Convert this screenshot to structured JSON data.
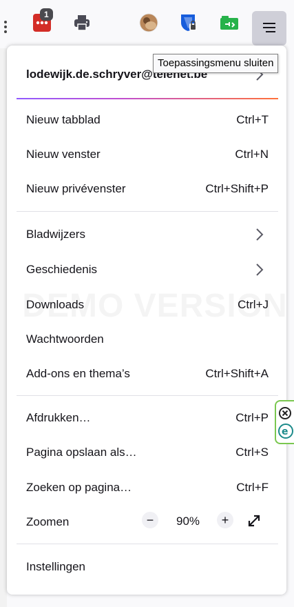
{
  "toolbar": {
    "badge_count": "1",
    "icons": [
      "lastpass-icon",
      "printer-icon",
      "profile-avatar",
      "bitwarden-icon",
      "green-extension-icon",
      "hamburger-menu-icon"
    ]
  },
  "tooltip": "Toepassingsmenu sluiten",
  "menu": {
    "account": "lodewijk.de.schryver@telenet.be",
    "items": {
      "new_tab": {
        "label": "Nieuw tabblad",
        "shortcut": "Ctrl+T"
      },
      "new_window": {
        "label": "Nieuw venster",
        "shortcut": "Ctrl+N"
      },
      "new_private": {
        "label": "Nieuw privévenster",
        "shortcut": "Ctrl+Shift+P"
      },
      "bookmarks": {
        "label": "Bladwijzers"
      },
      "history": {
        "label": "Geschiedenis"
      },
      "downloads": {
        "label": "Downloads",
        "shortcut": "Ctrl+J"
      },
      "passwords": {
        "label": "Wachtwoorden"
      },
      "addons": {
        "label": "Add-ons en thema’s",
        "shortcut": "Ctrl+Shift+A"
      },
      "print": {
        "label": "Afdrukken…",
        "shortcut": "Ctrl+P"
      },
      "save_page": {
        "label": "Pagina opslaan als…",
        "shortcut": "Ctrl+S"
      },
      "find": {
        "label": "Zoeken op pagina…",
        "shortcut": "Ctrl+F"
      },
      "zoom": {
        "label": "Zoomen",
        "value": "90%",
        "minus": "−",
        "plus": "+"
      },
      "settings": {
        "label": "Instellingen"
      }
    }
  },
  "watermark": "DEMO VERSION",
  "colors": {
    "accent_gradient": [
      "#9059ff",
      "#ff7139"
    ],
    "menu_bg": "#ffffff",
    "text": "#15141a"
  }
}
